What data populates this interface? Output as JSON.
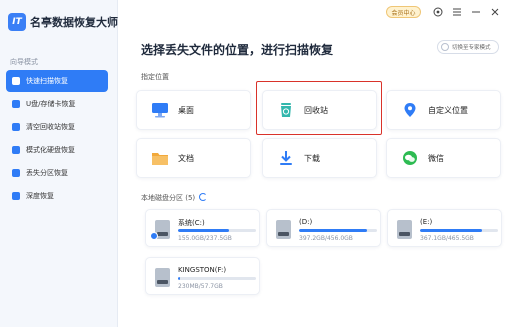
{
  "app": {
    "logo_text": "IT",
    "name": "名亭数据恢复大师"
  },
  "sidebar": {
    "section_label": "向导模式",
    "items": [
      {
        "label": "快速扫描恢复",
        "icon": "quick-scan-icon",
        "active": true
      },
      {
        "label": "U盘/存储卡恢复",
        "icon": "usb-icon",
        "active": false
      },
      {
        "label": "清空回收站恢复",
        "icon": "recycle-bin-icon",
        "active": false
      },
      {
        "label": "模式化硬盘恢复",
        "icon": "disk-icon",
        "active": false
      },
      {
        "label": "丢失分区恢复",
        "icon": "partition-icon",
        "active": false
      },
      {
        "label": "深度恢复",
        "icon": "deep-scan-icon",
        "active": false
      }
    ]
  },
  "topbar": {
    "member_label": "会员中心",
    "icons": [
      "help-icon",
      "menu-icon",
      "minimize-icon",
      "close-icon"
    ]
  },
  "main": {
    "title": "选择丢失文件的位置，进行扫描恢复",
    "mode_switch_label": "切换至专家模式",
    "locations_label": "指定位置",
    "locations": [
      {
        "label": "桌面",
        "icon": "desktop-icon",
        "color": "#2f7cf6"
      },
      {
        "label": "回收站",
        "icon": "recycle-bin-icon",
        "color": "#33b7ad"
      },
      {
        "label": "自定义位置",
        "icon": "location-pin-icon",
        "color": "#2f7cf6"
      },
      {
        "label": "文档",
        "icon": "folder-icon",
        "color": "#f2a93b"
      },
      {
        "label": "下载",
        "icon": "download-icon",
        "color": "#2f7cf6"
      },
      {
        "label": "微信",
        "icon": "wechat-icon",
        "color": "#2dbb52"
      }
    ],
    "disks_label": "本地磁盘分区 (5)",
    "disks": [
      {
        "name": "系统(C:)",
        "size": "155.0GB/237.5GB",
        "used_fraction": 0.65,
        "system": true
      },
      {
        "name": "(D:)",
        "size": "397.2GB/456.0GB",
        "used_fraction": 0.87,
        "system": false
      },
      {
        "name": "(E:)",
        "size": "367.1GB/465.5GB",
        "used_fraction": 0.79,
        "system": false
      },
      {
        "name": "KINGSTON(F:)",
        "size": "230MB/57.7GB",
        "used_fraction": 0.004,
        "system": false
      }
    ]
  },
  "colors": {
    "accent": "#2f7cf6",
    "highlight": "#d9322a"
  }
}
